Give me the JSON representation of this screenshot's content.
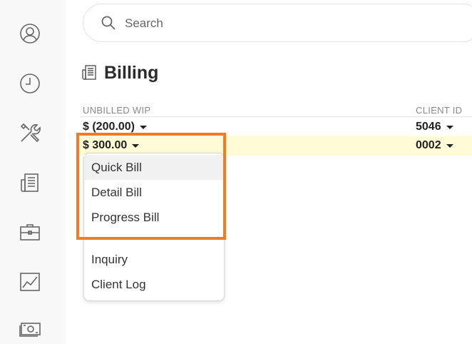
{
  "sidebar": {
    "icons": [
      "user-icon",
      "clock-icon",
      "tools-icon",
      "document-icon",
      "briefcase-icon",
      "chart-icon",
      "cash-icon"
    ]
  },
  "search": {
    "placeholder": "Search"
  },
  "page": {
    "title": "Billing"
  },
  "table": {
    "columns": [
      "UNBILLED WIP",
      "CLIENT ID"
    ],
    "rows": [
      {
        "unbilled_wip": "$ (200.00)",
        "client_id": "5046"
      },
      {
        "unbilled_wip": "$ 300.00",
        "client_id": "0002"
      }
    ]
  },
  "menu": {
    "items": [
      "Quick Bill",
      "Detail Bill",
      "Progress Bill",
      "Inquiry",
      "Client Log"
    ]
  },
  "colors": {
    "callout": "#f47b20",
    "highlight_row": "#fffbd6"
  }
}
